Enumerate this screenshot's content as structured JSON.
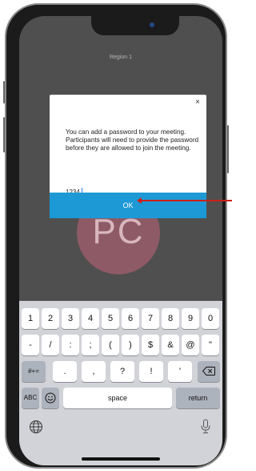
{
  "screen": {
    "region_label": "Region 1",
    "avatar_initials": "PC"
  },
  "dialog": {
    "close_label": "×",
    "message": "You can add a password to your meeting. Participants will need to provide the password before they are allowed to join the meeting.",
    "password_value": "1234",
    "ok_label": "OK"
  },
  "keyboard": {
    "row1": [
      "1",
      "2",
      "3",
      "4",
      "5",
      "6",
      "7",
      "8",
      "9",
      "0"
    ],
    "row2": [
      "-",
      "/",
      ":",
      ";",
      "(",
      ")",
      "$",
      "&",
      "@",
      "\""
    ],
    "row3_left": "#+=",
    "row3_mid": [
      ".",
      ",",
      "?",
      "!",
      "'"
    ],
    "row3_right_icon": "backspace-icon",
    "abc_label": "ABC",
    "emoji_icon": "emoji-icon",
    "space_label": "space",
    "return_label": "return",
    "globe_icon": "globe-icon",
    "mic_icon": "microphone-icon"
  },
  "colors": {
    "ok_button": "#1d9ad6",
    "annotation_arrow": "#cc1f1a",
    "avatar": "#8e5a66"
  }
}
